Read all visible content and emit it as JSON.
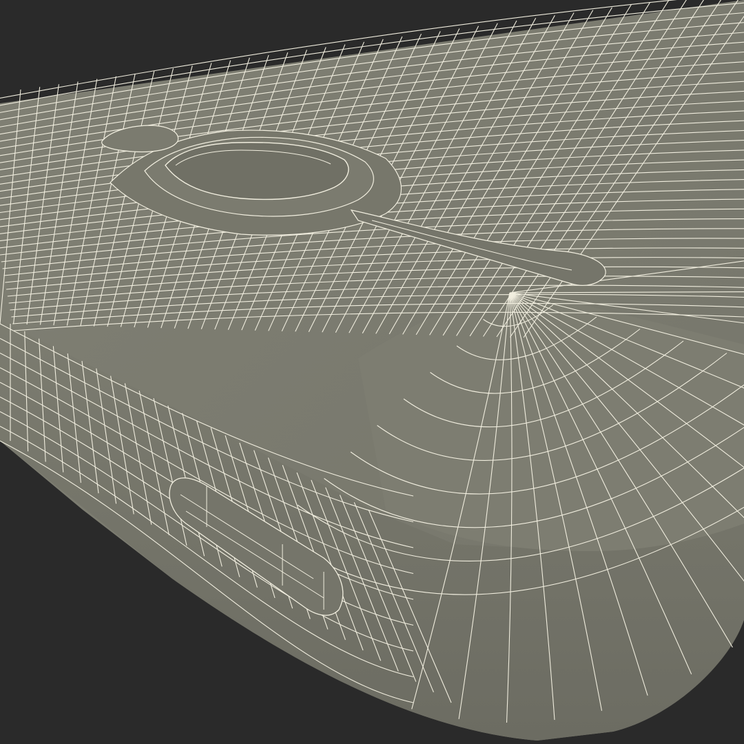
{
  "scene": {
    "subject": "phone-back-wireframe",
    "colors": {
      "background": "#2a2a2a",
      "surface": "#7a7a6e",
      "surface_shade": "#6e6e63",
      "surface_light": "#85857a",
      "wire": "#f1eedf"
    }
  }
}
